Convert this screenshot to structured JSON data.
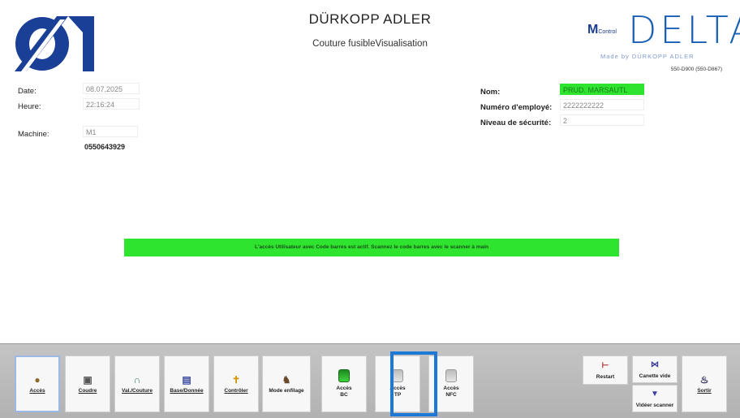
{
  "header": {
    "brand_title": "DÜRKOPP ADLER",
    "brand_subtitle": "Couture fusibleVisualisation",
    "delta_prefix": "M",
    "delta_prefix_small": "Control",
    "delta_word": "DELTA",
    "delta_made": "Made by DÜRKOPP ADLER",
    "delta_code": "550-D900 (550-D867)"
  },
  "info": {
    "date_label": "Date:",
    "date_value": "08.07.2025",
    "heure_label": "Heure:",
    "heure_value": "22:16:24",
    "machine_label": "Machine:",
    "machine_value": "M1",
    "machine_serial": "0550643929",
    "nom_label": "Nom:",
    "nom_value": "PRUD. MARSAUTL",
    "employe_label": "Numéro d'employé:",
    "employe_value": "2222222222",
    "securite_label": "Niveau de sécurité:",
    "securite_value": "2"
  },
  "message": "L'accès Utilisateur avec Code barres est actif. Scannez le code barres avec le scanner à main",
  "toolbar": {
    "acces": "Accès",
    "coudre": "Coudre",
    "val_couture": "Val./Couture",
    "base_donnee": "Base/Donnée",
    "controler": "Contrôler",
    "mode_enfilage": "Mode enfilage",
    "acces_bc_1": "Accès",
    "acces_bc_2": "BC",
    "acces_tp_1": "Accès",
    "acces_tp_2": "TP",
    "acces_nfc_1": "Accès",
    "acces_nfc_2": "NFC",
    "restart": "Restart",
    "canette_vide": "Canette vide",
    "vider_scanner": "Vidéer scanner",
    "sortir": "Sortir"
  },
  "colors": {
    "accent_blue": "#1e78d6",
    "active_green": "#2fe42f",
    "brand_blue": "#1a5fb4"
  }
}
